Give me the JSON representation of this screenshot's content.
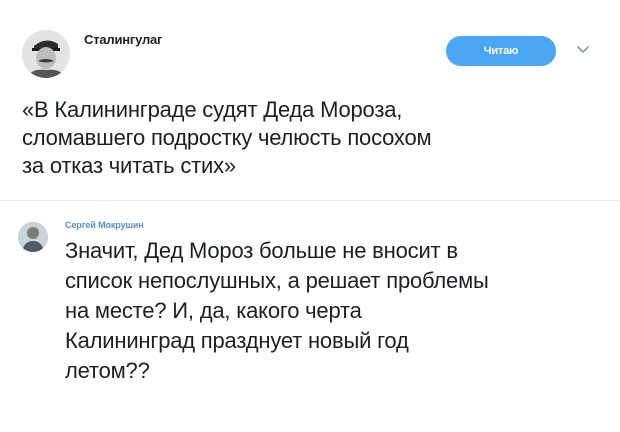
{
  "tweet": {
    "author": {
      "name": "Сталингулаг",
      "avatar_icon": "portrait-avatar-icon"
    },
    "follow_button": {
      "label": "Читаю",
      "color": "#4aa6f2"
    },
    "menu_icon": "chevron-down-icon",
    "text": "«В Калининграде судят Деда Мороза,\nсломавшего подростку челюсть посохом\nза отказ читать стих»"
  },
  "reply": {
    "author": {
      "name": "Сергей Мокрушин",
      "avatar_icon": "portrait-avatar-icon"
    },
    "text": "Значит, Дед Мороз больше не вносит в\nсписок непослушных, а решает проблемы\nна месте? И, да, какого черта\nКалининград празднует новый год\nлетом??"
  }
}
